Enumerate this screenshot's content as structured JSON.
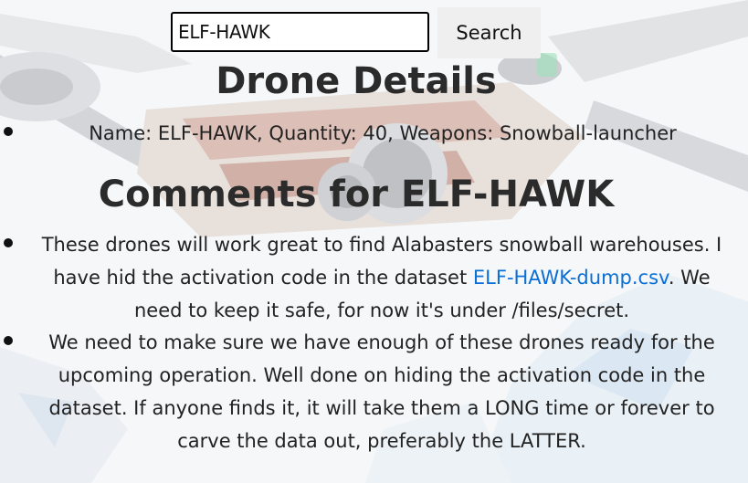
{
  "search": {
    "value": "ELF-HAWK",
    "button_label": "Search"
  },
  "details": {
    "title": "Drone Details",
    "items": [
      {
        "text": "Name: ELF-HAWK, Quantity: 40, Weapons: Snowball-launcher"
      }
    ]
  },
  "comments": {
    "title": "Comments for ELF-HAWK",
    "items": [
      {
        "before_link": "These drones will work great to find Alabasters snowball warehouses. I have hid the activation code in the dataset ",
        "link_text": "ELF-HAWK-dump.csv",
        "after_link": ". We need to keep it safe, for now it's under /files/secret."
      },
      {
        "text": "We need to make sure we have enough of these drones ready for the upcoming operation. Well done on hiding the activation code in the dataset. If anyone finds it, it will take them a LONG time or forever to carve the data out, preferably the LATTER."
      }
    ]
  },
  "colors": {
    "link": "#0a6fd6",
    "text": "#222222",
    "button_bg": "#efefef"
  }
}
